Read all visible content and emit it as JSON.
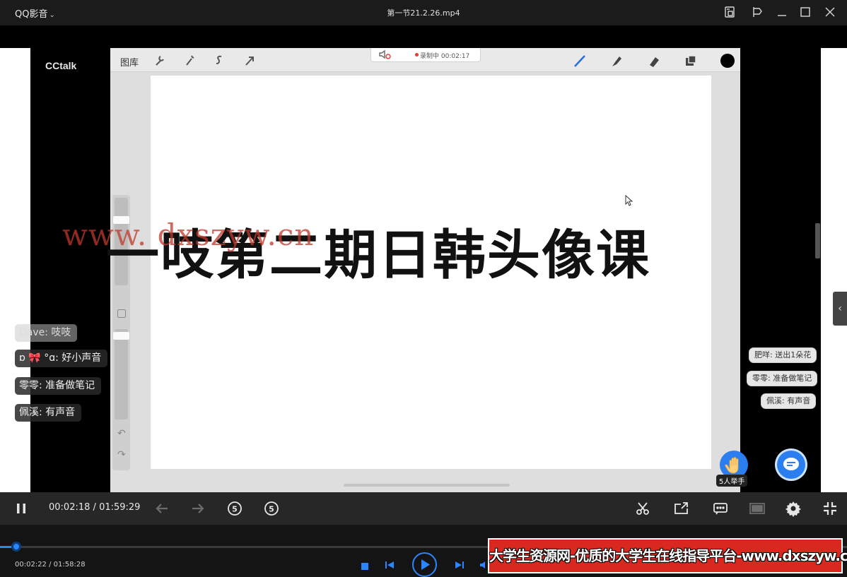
{
  "titlebar": {
    "app_name": "QQ影音",
    "file_title": "第一节21.2.26.mp4"
  },
  "video": {
    "cctalk_logo": "CCtalk",
    "draw_app": {
      "gallery_label": "图库",
      "recording_status": "录制中 00:02:17",
      "brush_color": "#000000"
    },
    "slide_title": "一吱第二期日韩头像课",
    "watermark": "www. dxszyw.cn",
    "chat_left": [
      {
        "text": "Dave: 吱吱"
      },
      {
        "text": "ɒ 🎀 °ɑ: 好小声音"
      },
      {
        "text": "零零: 准备做笔记"
      },
      {
        "text": "佩溪: 有声音"
      }
    ],
    "chat_right": [
      {
        "text": "肥咩: 送出1朵花"
      },
      {
        "text": "零零: 准备做笔记"
      },
      {
        "text": "佩溪: 有声音"
      }
    ],
    "raise_hand_label": "5人举手"
  },
  "controls": {
    "current_time": "00:02:18",
    "separator": "/",
    "total_time": "01:59:29"
  },
  "outer": {
    "time_display": "00:02:22 / 01:58:28",
    "progress_fraction": 0.019,
    "banner_text": "大学生资源网-优质的大学生在线指导平台-www.dxszyw.cn",
    "accent_color": "#2a86ff"
  }
}
